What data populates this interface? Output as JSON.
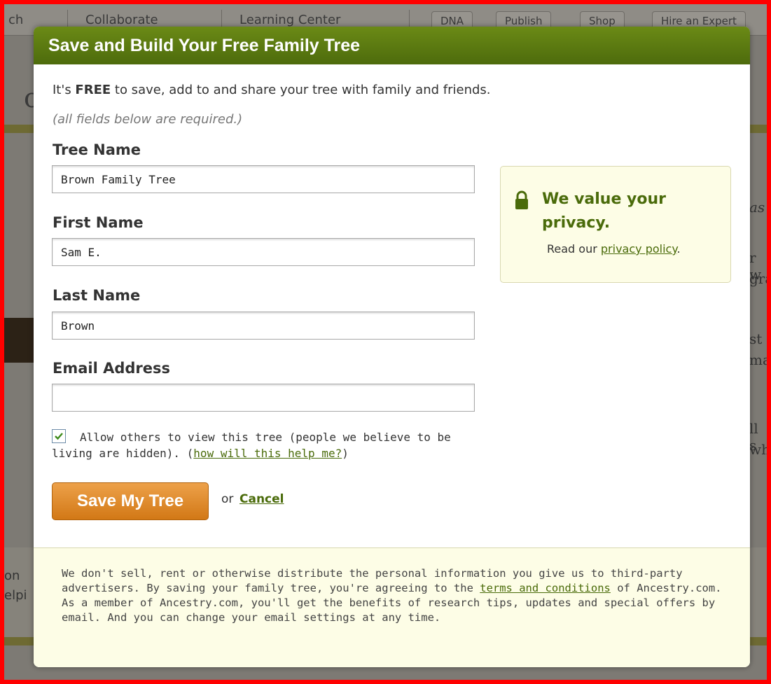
{
  "background": {
    "nav": [
      "ch",
      "Collaborate",
      "Learning Center"
    ],
    "pills": [
      "DNA",
      "Publish",
      "Shop",
      "Hire an Expert"
    ],
    "title_fragment": "ct",
    "right_fragments": [
      "as",
      "r w",
      "gra",
      "st",
      "ma",
      "ll s",
      "wh"
    ],
    "left_fragments": [
      "on",
      "elpi"
    ]
  },
  "dialog": {
    "title": "Save and Build Your Free Family Tree",
    "intro_before": "It's ",
    "intro_bold": "FREE",
    "intro_after": " to save, add to and share your tree with family and friends.",
    "required_note": "(all fields below are required.)",
    "fields": {
      "tree_name": {
        "label": "Tree Name",
        "value": "Brown Family Tree"
      },
      "first_name": {
        "label": "First Name",
        "value": "Sam E."
      },
      "last_name": {
        "label": "Last Name",
        "value": "Brown"
      },
      "email": {
        "label": "Email Address",
        "value": ""
      }
    },
    "privacy": {
      "title": "We value your privacy.",
      "read_prefix": "Read our ",
      "link": "privacy policy",
      "suffix": "."
    },
    "allow": {
      "checked": true,
      "text": "Allow others to view this tree (people we believe to be living are hidden). (",
      "link": "how will this help me?",
      "close": ")"
    },
    "save_button": "Save My Tree",
    "or": "or",
    "cancel": "Cancel",
    "footer": {
      "text1": "We don't sell, rent or otherwise distribute the personal information you give us to third-party advertisers. By saving your family tree, you're agreeing to the ",
      "link": "terms and conditions",
      "text2": " of Ancestry.com. As a member of Ancestry.com, you'll get the benefits of research tips, updates and special offers by email. And you can change your email settings at any time."
    }
  },
  "colors": {
    "header_green": "#5b7b11",
    "link_green": "#4a6b0a",
    "button_orange": "#e08a2a",
    "privacy_bg": "#fdfde6",
    "border_red": "#ff0000"
  }
}
